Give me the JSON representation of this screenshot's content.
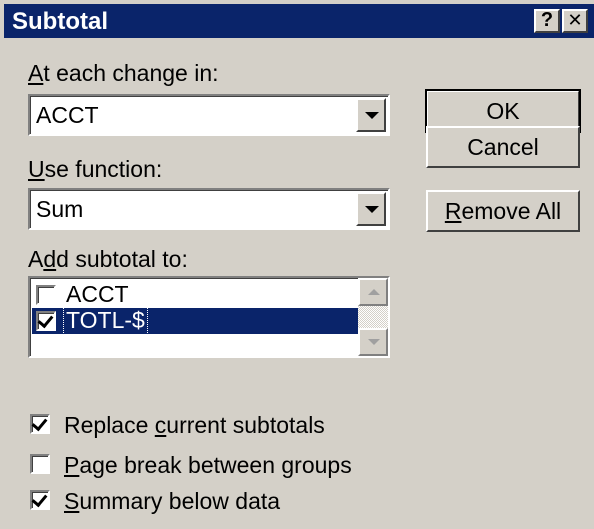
{
  "dialog": {
    "title": "Subtotal",
    "help_label": "?",
    "close_label": "✕"
  },
  "at_each_change": {
    "label_hot": "A",
    "label_rest": "t each change in:",
    "value": "ACCT"
  },
  "use_function": {
    "label_hot": "U",
    "label_rest": "se function:",
    "value": "Sum"
  },
  "add_subtotal": {
    "label_pre": "A",
    "label_hot": "d",
    "label_rest": "d subtotal to:",
    "items": [
      {
        "label": "ACCT",
        "checked": false,
        "selected": false
      },
      {
        "label": "TOTL-$",
        "checked": true,
        "selected": true
      }
    ]
  },
  "buttons": {
    "ok": "OK",
    "cancel": "Cancel",
    "remove_all_hot": "R",
    "remove_all_rest": "emove All"
  },
  "options": {
    "replace": {
      "pre": "Replace ",
      "hot": "c",
      "rest": "urrent subtotals",
      "checked": true
    },
    "page_break": {
      "pre": "",
      "hot": "P",
      "rest": "age break between groups",
      "checked": false
    },
    "summary": {
      "pre": "",
      "hot": "S",
      "rest": "ummary below data",
      "checked": true
    }
  },
  "colors": {
    "titlebar": "#0a246a",
    "face": "#d4d0c8",
    "selection": "#0a246a"
  },
  "icons": [
    "help-icon",
    "close-icon",
    "dropdown-arrow-icon",
    "scroll-up-icon",
    "scroll-down-icon",
    "checkmark-icon"
  ]
}
